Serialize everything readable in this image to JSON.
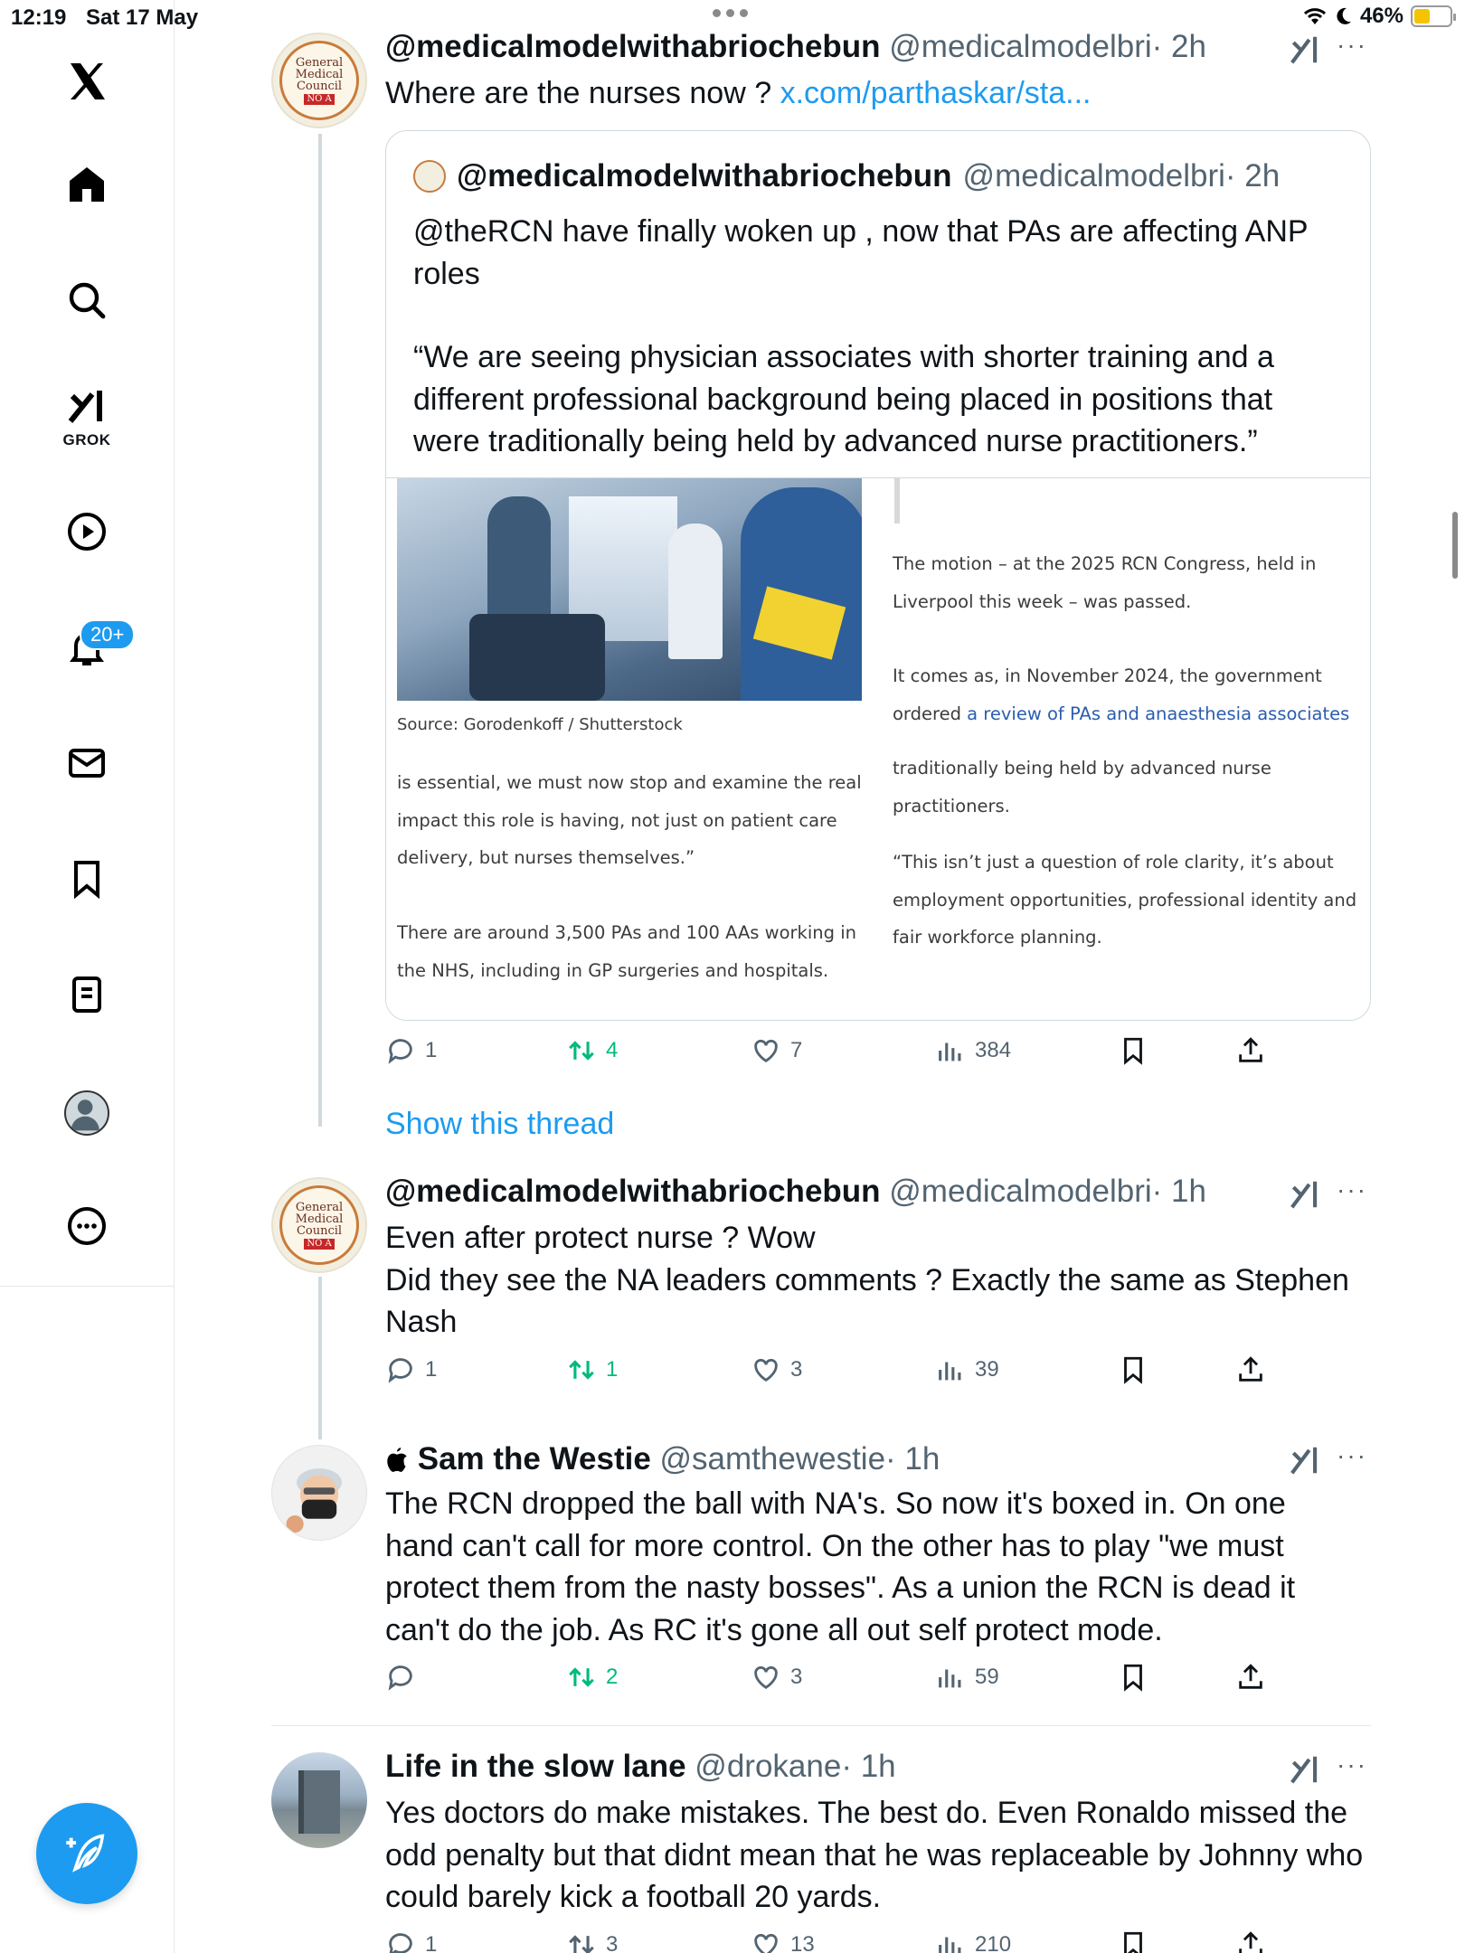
{
  "status_bar": {
    "time": "12:19",
    "date": "Sat 17 May",
    "battery": "46%"
  },
  "sidebar": {
    "grok_label": "GROK",
    "notifications_badge": "20+"
  },
  "tweets": [
    {
      "name": "@medicalmodelwithabriochebun",
      "handle": "@medicalmodelbri",
      "time": "· 2h",
      "text": "Where are the nurses now ? ",
      "link": "x.com/parthaskar/sta...",
      "quote": {
        "name": "@medicalmodelwithabriochebun",
        "handle": "@medicalmodelbri",
        "time": "· 2h",
        "text_line1": "@theRCN have finally woken up , now that PAs are affecting ANP roles",
        "text_line2": "“We are seeing physician associates with shorter training and a different professional background being placed in positions that were traditionally being held by advanced nurse practitioners.”",
        "article": {
          "photo_caption": "Source:  Gorodenkoff / Shutterstock",
          "left_para1": "is essential, we must now stop and examine the real impact this role is having, not just on patient care delivery, but nurses themselves.”",
          "left_para2": "There are around 3,500 PAs and 100 AAs working in the NHS, including in GP surgeries and hospitals.",
          "right_para1": "The motion – at the 2025 RCN Congress, held in Liverpool this week – was passed.",
          "right_para2_prefix": "It comes as, in November 2024, the government ordered ",
          "right_para2_link": "a review of PAs and anaesthesia associates",
          "right_para3": "traditionally being held by advanced nurse practitioners.",
          "right_para4": "“This isn’t just a question of role clarity, it’s about employment opportunities, professional identity and fair workforce planning."
        }
      },
      "replies": "1",
      "reposts": "4",
      "likes": "7",
      "views": "384"
    },
    {
      "name": "@medicalmodelwithabriochebun",
      "handle": "@medicalmodelbri",
      "time": "· 1h",
      "text": "Even after protect nurse ? Wow\nDid they see the NA leaders comments ? Exactly the same as Stephen Nash",
      "replies": "1",
      "reposts": "1",
      "likes": "3",
      "views": "39"
    },
    {
      "name": "Sam the Westie",
      "handle": "@samthewestie",
      "time": "· 1h",
      "text": "The RCN dropped the ball with NA's. So now it's boxed in. On one hand can't call for more control. On the other has to play \"we must protect them from the nasty bosses\". As a union the RCN is dead it can't do the job. As RC it's gone all out self protect mode.",
      "replies": "",
      "reposts": "2",
      "likes": "3",
      "views": "59"
    },
    {
      "name": "Life in the slow lane",
      "handle": "@drokane",
      "time": "· 1h",
      "text": "Yes doctors do make mistakes. The best do. Even Ronaldo missed the odd penalty but that didnt mean  that he was replaceable by Johnny who could barely kick a football 20 yards.",
      "replies": "1",
      "reposts": "3",
      "likes": "13",
      "views": "210"
    }
  ],
  "show_thread": "Show this thread",
  "colors": {
    "accent": "#1d9bf0",
    "repost": "#00ba7c",
    "muted": "#536471"
  }
}
